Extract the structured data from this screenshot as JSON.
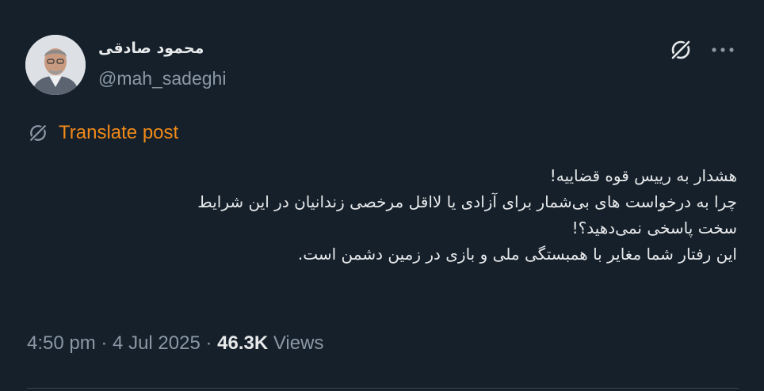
{
  "author": {
    "display_name": "محمود صادقی",
    "handle": "@mah_sadeghi"
  },
  "header": {
    "grok_icon": "grok-icon",
    "more_icon": "more-horizontal-icon",
    "more_label": "···"
  },
  "translate": {
    "icon": "grok-icon",
    "label": "Translate post",
    "color": "#f28a18"
  },
  "tweet": {
    "lines": [
      "هشدار به رییس قوه قضاییه!",
      "چرا به درخواست های بی‌شمار برای آزادی یا لااقل مرخصی زندانیان در این شرایط",
      "سخت پاسخی نمی‌دهید؟!",
      "این رفتار شما مغایر با همبستگی ملی و بازی در زمین دشمن است."
    ]
  },
  "meta": {
    "time": "4:50 pm",
    "separator": " · ",
    "date": "4 Jul 2025",
    "views_count": "46.3K",
    "views_label": "Views"
  },
  "colors": {
    "background": "#15202b",
    "text": "#e7e9ea",
    "muted": "#8b98a5",
    "accent": "#f28a18"
  }
}
